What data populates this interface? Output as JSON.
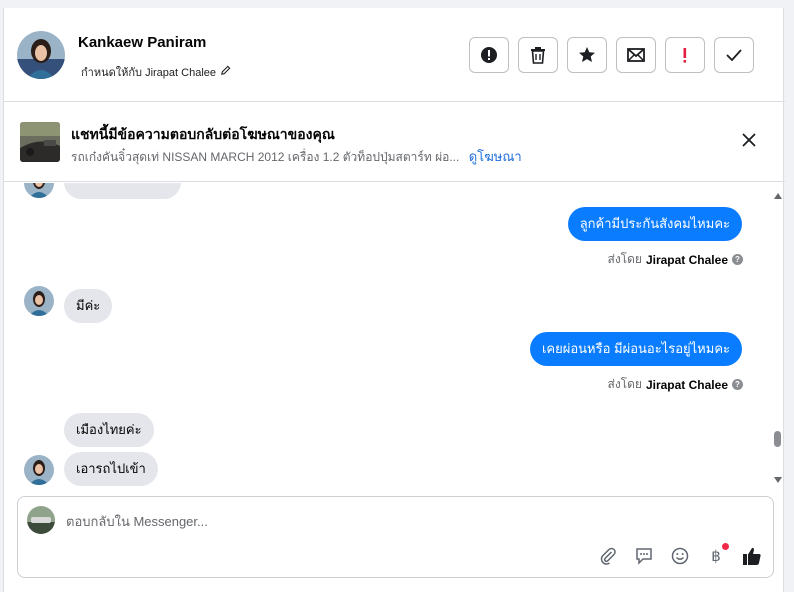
{
  "header": {
    "contact_name": "Kankaew Paniram",
    "assigned_text": "กำหนดให้กับ Jirapat Chalee",
    "actions": [
      {
        "name": "alert-icon"
      },
      {
        "name": "trash-icon"
      },
      {
        "name": "star-icon"
      },
      {
        "name": "envelope-icon"
      },
      {
        "name": "exclamation-icon",
        "color": "#e41e3f"
      },
      {
        "name": "check-icon"
      }
    ]
  },
  "ad": {
    "title": "แชทนี้มีข้อความตอบกลับต่อโฆษณาของคุณ",
    "subtitle": "รถเก๋งคันจิ๋วสุดเท่ NISSAN MARCH 2012 เครื่อง 1.2 ตัวท็อปปุ่มสตาร์ท ผ่อ...",
    "link": "ดูโฆษณา"
  },
  "messages": {
    "m1": "ลูกค้ามีประกันสังคมไหมคะ",
    "m2": "มีค่ะ",
    "m3": "เคยผ่อนหรือ มีผ่อนอะไรอยู่ไหมคะ",
    "m4": "เมืองไทยค่ะ",
    "m5": "เอารถไปเข้า"
  },
  "sent_by": {
    "prefix": "ส่งโดย",
    "name": "Jirapat Chalee"
  },
  "composer": {
    "placeholder": "ตอบกลับใน Messenger..."
  },
  "colors": {
    "accent": "#0a7cff",
    "incoming": "#e4e6eb",
    "link": "#216fdb",
    "badge": "#f02849"
  }
}
